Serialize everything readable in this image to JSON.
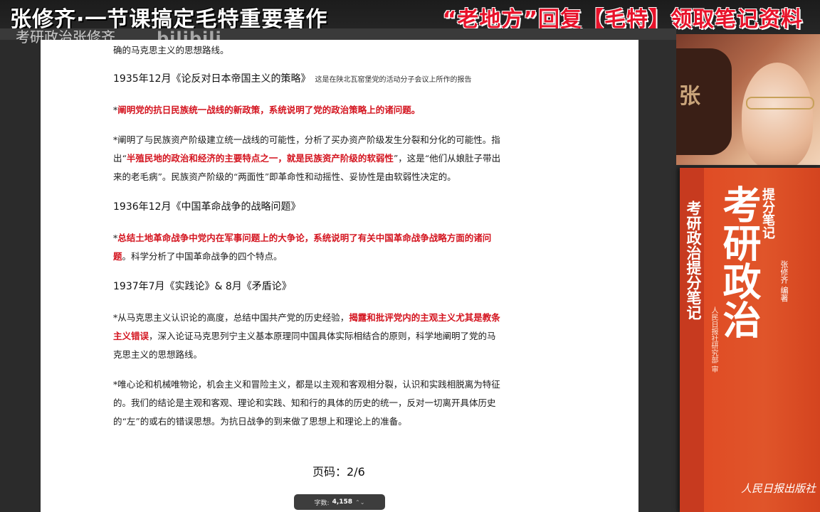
{
  "banner": {
    "left_title": "张修齐·一节课搞定毛特重要著作",
    "right_title": "“老地方”回复【毛特】领取笔记资料"
  },
  "watermark": {
    "text": "考研政治张修齐",
    "logo": "bilibili"
  },
  "document": {
    "lines": [
      {
        "type": "text",
        "text": "确的马克思主义的思想路线。"
      },
      {
        "type": "heading",
        "text": "1935年12月《论反对日本帝国主义的策略》",
        "note": "这是在陕北瓦窑堡党的活动分子会议上所作的报告"
      },
      {
        "type": "red",
        "text": "*阐明党的抗日民族统一战线的新政策，系统说明了党的政治策略上的诸问题。"
      },
      {
        "type": "text",
        "text": "*阐明了与民族资产阶级建立统一战线的可能性，分析了买办资产阶级发生分裂和分化的可能性。指"
      },
      {
        "type": "mixed",
        "parts": [
          "出“",
          "半殖民地的政治和经济的主要特点之一，就是民族资产阶级的软弱性",
          "”，这是“他们从娘肚子带出"
        ]
      },
      {
        "type": "text",
        "text": "来的老毛病”。民族资产阶级的“两面性”即革命性和动摇性、妥协性是由软弱性决定的。"
      },
      {
        "type": "heading",
        "text": "1936年12月《中国革命战争的战略问题》",
        "note": ""
      },
      {
        "type": "red",
        "text": "*总结土地革命战争中党内在军事问题上的大争论，系统说明了有关中国革命战争战略方面的诸问"
      },
      {
        "type": "mixed",
        "parts": [
          "",
          "题",
          "。科学分析了中国革命战争的四个特点。"
        ]
      },
      {
        "type": "heading",
        "text": "1937年7月《实践论》& 8月《矛盾论》",
        "note": ""
      },
      {
        "type": "mixed",
        "parts": [
          "*从马克思主义认识论的高度，总结中国共产党的历史经验，",
          "揭露和批评党内的主观主义尤其是教条",
          ""
        ]
      },
      {
        "type": "mixed",
        "parts": [
          "",
          "主义错误",
          "，深入论证马克思列宁主义基本原理同中国具体实际相结合的原则，科学地阐明了党的马"
        ]
      },
      {
        "type": "text",
        "text": "克思主义的思想路线。"
      },
      {
        "type": "text",
        "text": "*唯心论和机械唯物论，机会主义和冒险主义，都是以主观和客观相分裂，认识和实践相脱离为特征"
      },
      {
        "type": "text",
        "text": "的。我们的结论是主观和客观、理论和实践、知和行的具体的历史的统一，反对一切离开具体历史"
      },
      {
        "type": "text",
        "text": "的“左”的或右的错误思想。为抗日战争的到来做了思想上和理论上的准备。"
      }
    ],
    "page_label": "页码：2/6"
  },
  "wordcount": {
    "label": "字数:",
    "value": "4,158",
    "arrows": "⌃⌄"
  },
  "book": {
    "spine": "考研政治提分笔记",
    "title": "考研政治",
    "subtitle": "提分笔记",
    "author": "张修齐 编著",
    "editor": "人民日报社研究部 审",
    "publisher": "人民日报出版社"
  },
  "webcam": {
    "sign_char": "张"
  }
}
